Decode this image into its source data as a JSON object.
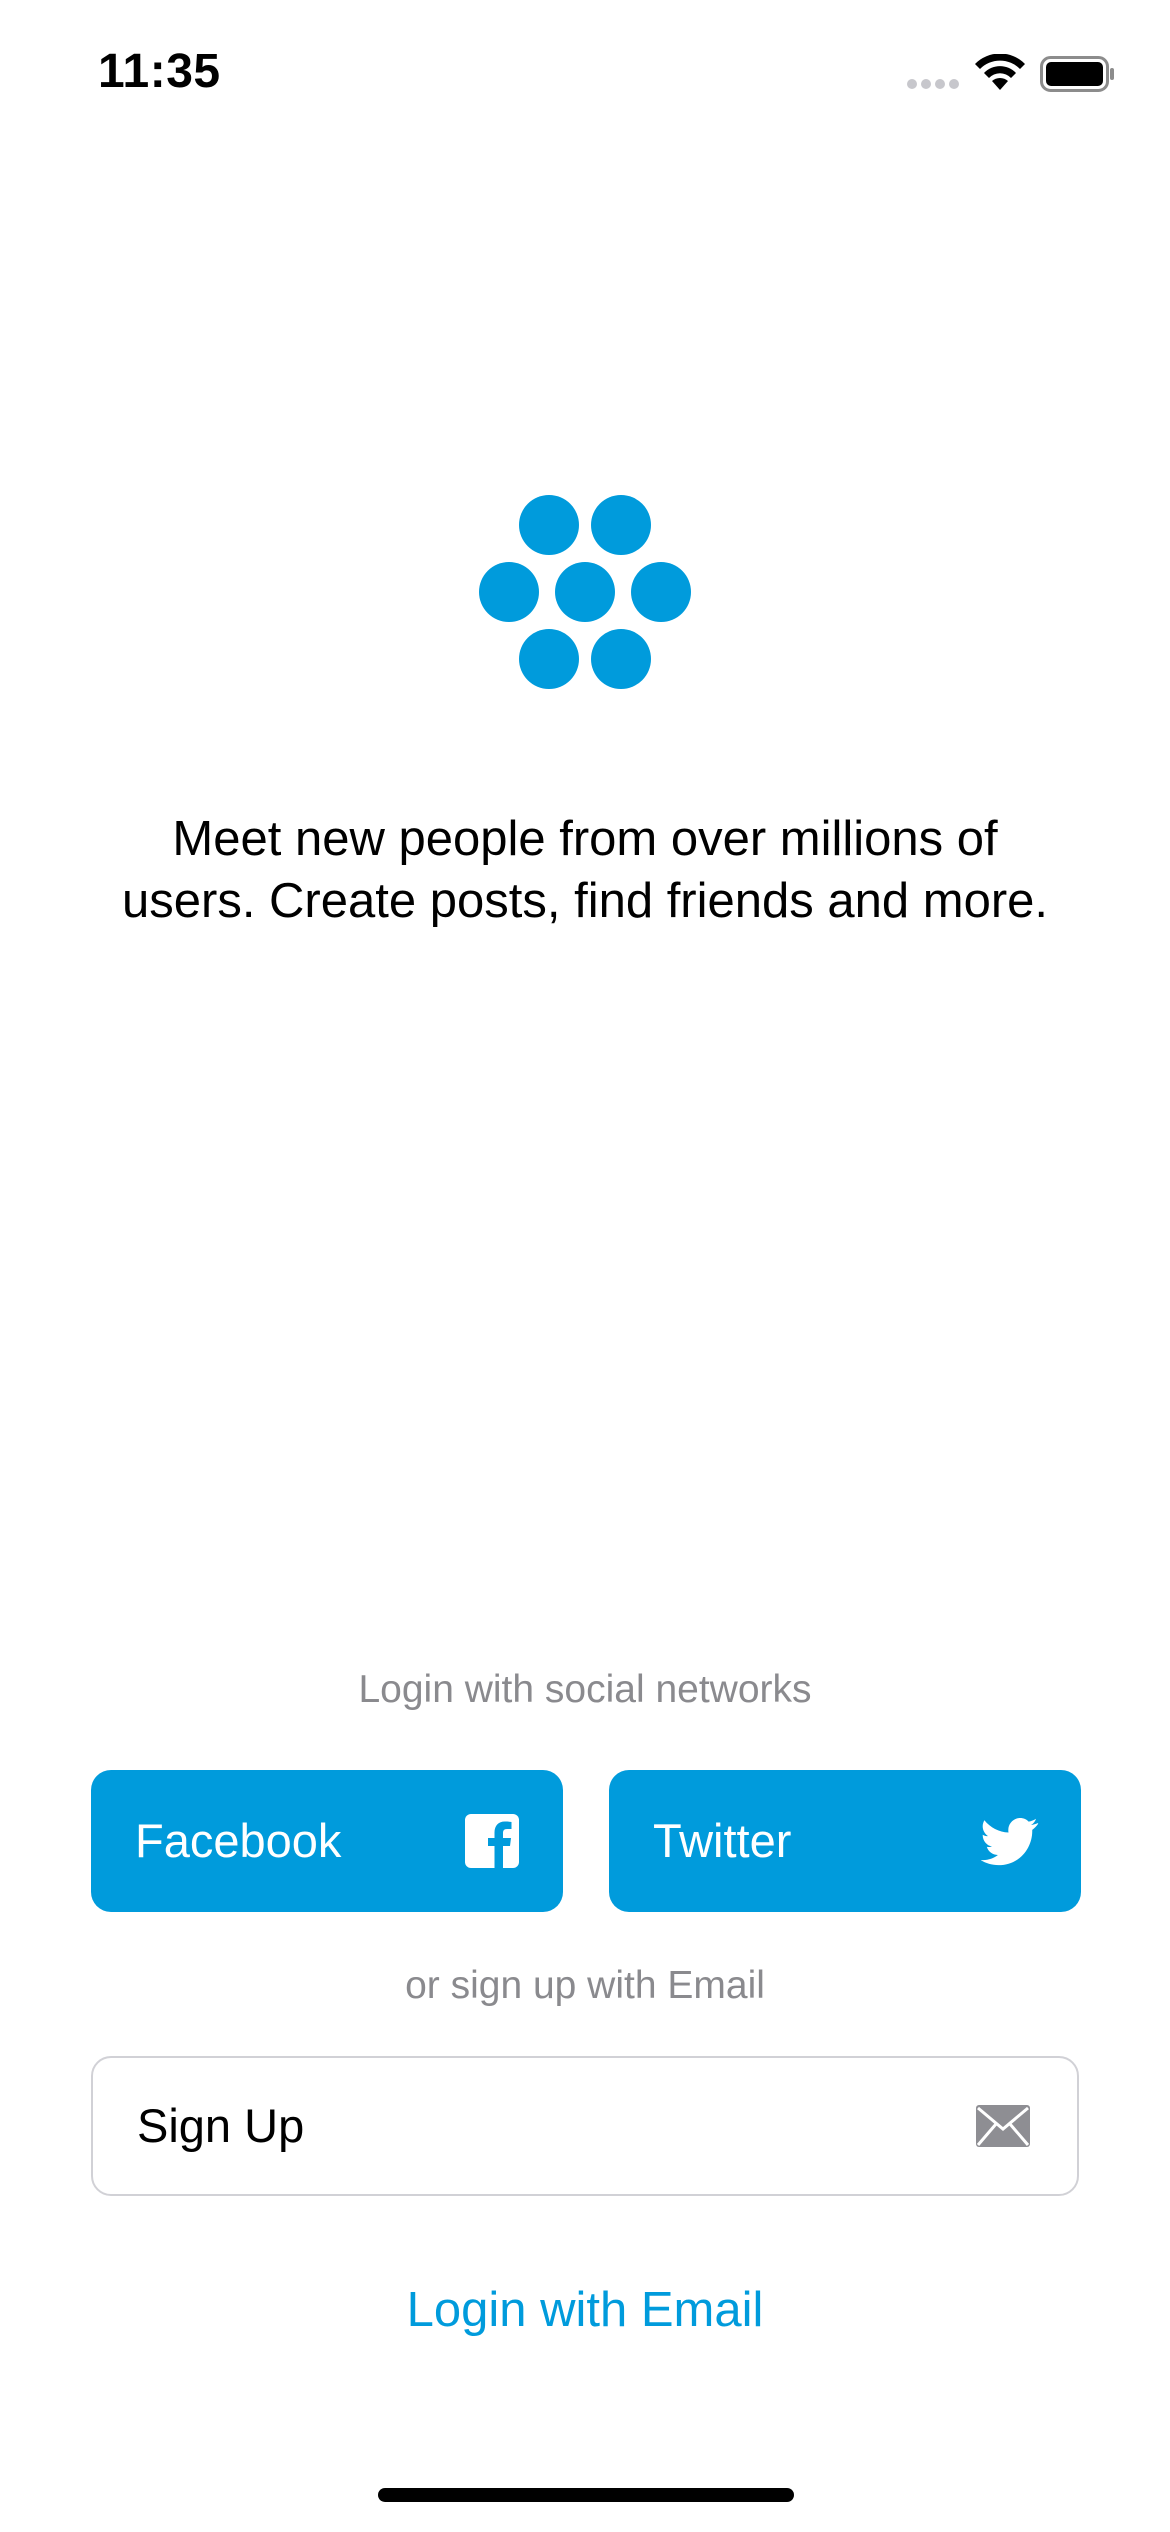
{
  "status_bar": {
    "time": "11:35",
    "icons": [
      "signal-dots-icon",
      "wifi-icon",
      "battery-icon"
    ]
  },
  "logo": {
    "icon": "dots-cluster-logo",
    "color": "#009bdc"
  },
  "tagline": {
    "line1": "Meet new people from over millions of",
    "line2": "users. Create posts, find friends and more."
  },
  "social": {
    "label": "Login with social networks",
    "facebook_label": "Facebook",
    "facebook_icon": "facebook-icon",
    "twitter_label": "Twitter",
    "twitter_icon": "twitter-bird-icon",
    "button_color": "#009bdc"
  },
  "email": {
    "label": "or sign up with Email",
    "signup_label": "Sign Up",
    "signup_icon": "envelope-icon",
    "login_link": "Login with Email",
    "link_color": "#009bdc"
  }
}
